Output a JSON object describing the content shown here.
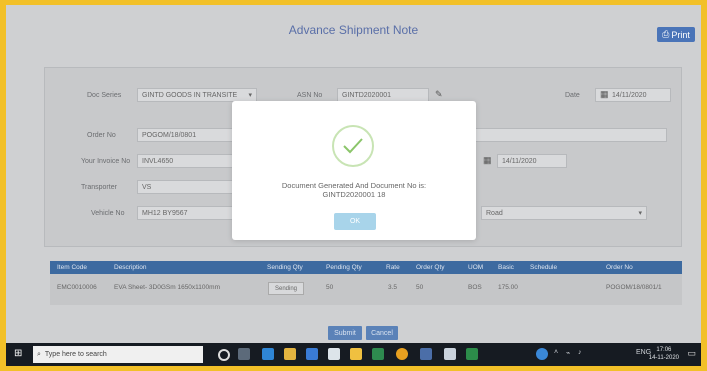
{
  "window": {
    "title": "Advance Shipment Note",
    "print_label": "Print"
  },
  "form": {
    "doc_series_label": "Doc Series",
    "doc_series_value": "GINTD GOODS IN TRANSITE",
    "asn_no_label": "ASN No",
    "asn_no_value": "GINTD2020001",
    "date_label": "Date",
    "date_value": "14/11/2020",
    "order_no_label": "Order No",
    "order_no_value": "POGOM/18/0801",
    "your_invoice_no_label": "Your Invoice No",
    "your_invoice_no_value": "INVL4650",
    "invoice_date_value": "14/11/2020",
    "transporter_label": "Transporter",
    "transporter_value": "VS",
    "vehicle_no_label": "Vehicle No",
    "vehicle_no_value": "MH12 BY9567",
    "mode_value": "Road"
  },
  "grid": {
    "headers": [
      "Item Code",
      "Description",
      "Sending Qty",
      "Pending Qty",
      "Rate",
      "Order Qty",
      "UOM",
      "Basic",
      "Schedule",
      "Order No"
    ],
    "rows": [
      {
        "item_code": "EMC0010006",
        "description": "EVA Sheet- 3D0GSm 1650x1100mm",
        "sending_qty": "Sending",
        "pending_qty": "50",
        "rate": "3.5",
        "order_qty": "50",
        "uom": "BOS",
        "basic": "175.00",
        "schedule": "",
        "order_no": "POGOM/18/0801/1"
      }
    ]
  },
  "actions": {
    "submit_label": "Submit",
    "cancel_label": "Cancel"
  },
  "modal": {
    "message_line1": "Document Generated And Document No is:",
    "message_line2": "GINTD2020001 18",
    "ok_label": "OK"
  },
  "taskbar": {
    "search_placeholder": "Type here to search",
    "tray_text": "ENG",
    "time": "17:06",
    "date": "14-11-2020"
  },
  "colors": {
    "frame": "#f2c028",
    "grid_header": "#3d6aa0",
    "button_blue": "#5b82b8",
    "success_green": "#8bc56a"
  }
}
